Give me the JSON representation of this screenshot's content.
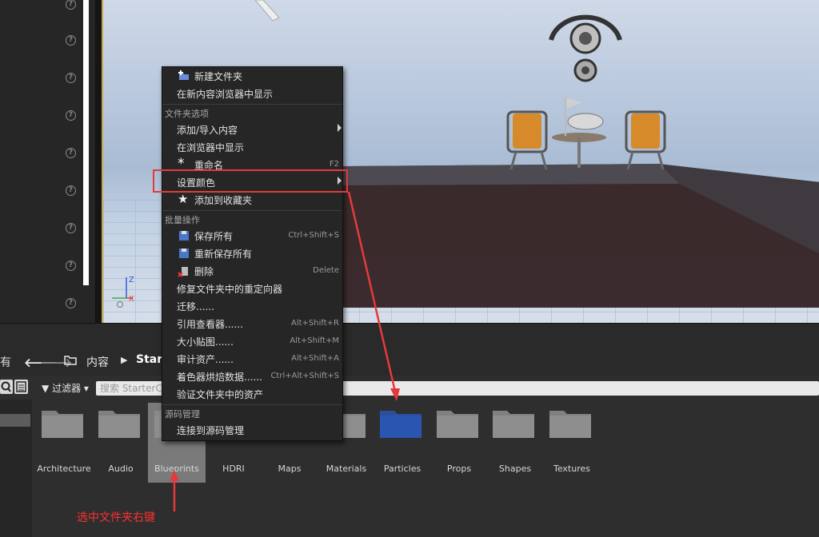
{
  "context_menu": {
    "items_top": [
      {
        "label": "新建文件夹",
        "icon": "new-folder-icon",
        "shortcut": ""
      },
      {
        "label": "在新内容浏览器中显示",
        "icon": "",
        "shortcut": ""
      }
    ],
    "section_folder_options": "文件夹选项",
    "folder_items": [
      {
        "label": "添加/导入内容",
        "submenu": true,
        "shortcut": ""
      },
      {
        "label": "在浏览器中显示",
        "submenu": false,
        "shortcut": ""
      },
      {
        "label": "重命名",
        "submenu": false,
        "shortcut": "F2",
        "icon": "asterisk-icon"
      },
      {
        "label": "设置颜色",
        "submenu": true,
        "shortcut": ""
      },
      {
        "label": "添加到收藏夹",
        "submenu": false,
        "shortcut": "",
        "icon": "star-icon"
      }
    ],
    "section_bulk": "批量操作",
    "bulk_items": [
      {
        "label": "保存所有",
        "shortcut": "Ctrl+Shift+S",
        "icon": "save-icon"
      },
      {
        "label": "重新保存所有",
        "shortcut": "",
        "icon": "resave-icon"
      },
      {
        "label": "删除",
        "shortcut": "Delete",
        "icon": "delete-icon"
      },
      {
        "label": "修复文件夹中的重定向器",
        "shortcut": ""
      },
      {
        "label": "迁移......",
        "shortcut": ""
      },
      {
        "label": "引用查看器......",
        "shortcut": "Alt+Shift+R"
      },
      {
        "label": "大小贴图......",
        "shortcut": "Alt+Shift+M"
      },
      {
        "label": "审计资产......",
        "shortcut": "Alt+Shift+A"
      },
      {
        "label": "着色器烘焙数据......",
        "shortcut": "Ctrl+Alt+Shift+S"
      },
      {
        "label": "验证文件夹中的资产",
        "shortcut": ""
      }
    ],
    "section_source": "源码管理",
    "source_items": [
      {
        "label": "连接到源码管理",
        "shortcut": ""
      }
    ]
  },
  "content_browser": {
    "nav_partial_label": "有",
    "breadcrumb_root": "内容",
    "breadcrumb_current": "Start",
    "filters_label": "过滤器",
    "search_placeholder": "搜索 StarterCo",
    "folders": [
      {
        "label": "Architecture",
        "color": "#8e8e8e",
        "selected": false
      },
      {
        "label": "Audio",
        "color": "#8e8e8e",
        "selected": false
      },
      {
        "label": "Blueprints",
        "color": "#8e8e8e",
        "selected": true
      },
      {
        "label": "HDRI",
        "color": "#8e8e8e",
        "selected": false
      },
      {
        "label": "Maps",
        "color": "#8e8e8e",
        "selected": false
      },
      {
        "label": "Materials",
        "color": "#8e8e8e",
        "selected": false
      },
      {
        "label": "Particles",
        "color": "#2a55b0",
        "selected": false
      },
      {
        "label": "Props",
        "color": "#8e8e8e",
        "selected": false
      },
      {
        "label": "Shapes",
        "color": "#8e8e8e",
        "selected": false
      },
      {
        "label": "Textures",
        "color": "#8e8e8e",
        "selected": false
      }
    ]
  },
  "annotation": {
    "text": "选中文件夹右键",
    "color": "#ff3030"
  },
  "colors": {
    "highlight_border": "#e53a3a",
    "particles_folder": "#2a55b0"
  }
}
